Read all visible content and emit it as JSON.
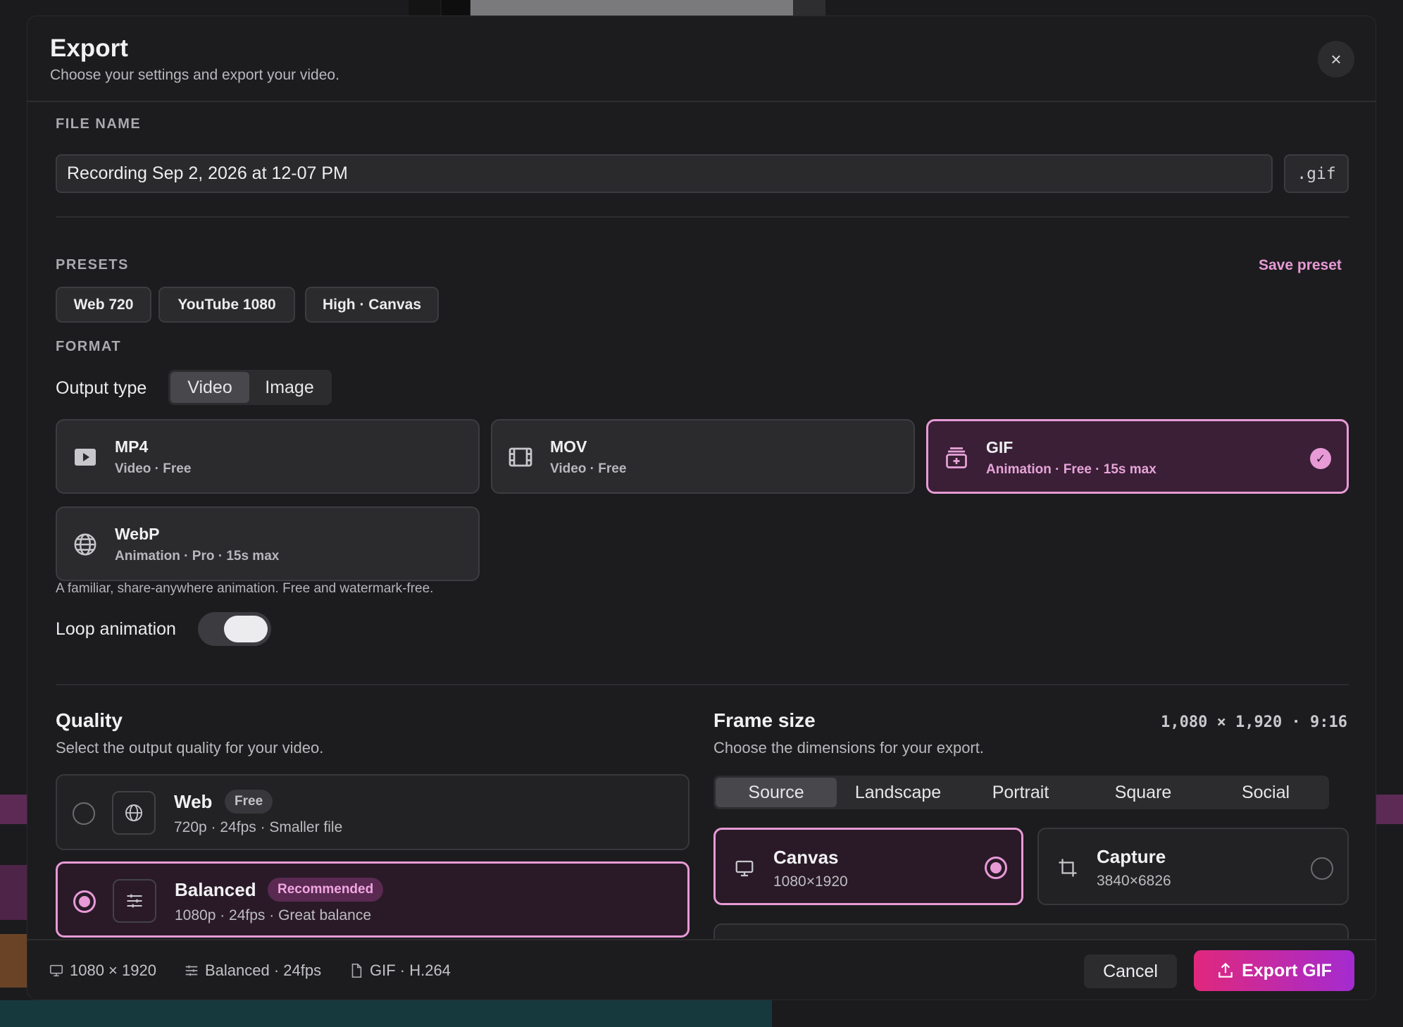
{
  "header": {
    "title": "Export",
    "subtitle": "Choose your settings and export your video.",
    "close_glyph": "×"
  },
  "file_name": {
    "label": "FILE NAME",
    "value": "Recording Sep 2, 2026 at 12-07 PM",
    "extension": ".gif"
  },
  "presets": {
    "label": "PRESETS",
    "save_label": "Save preset",
    "items": [
      "Web 720",
      "YouTube 1080",
      "High · Canvas"
    ]
  },
  "format": {
    "label": "FORMAT",
    "output_type_label": "Output type",
    "output_types": [
      "Video",
      "Image"
    ],
    "selected_output_type": "Video",
    "cards": [
      {
        "name": "MP4",
        "sub": "Video · Free",
        "icon": "play-icon"
      },
      {
        "name": "MOV",
        "sub": "Video · Free",
        "icon": "film-icon"
      },
      {
        "name": "GIF",
        "sub": "Animation · Free · 15s max",
        "icon": "gif-stack-icon",
        "selected": true
      },
      {
        "name": "WebP",
        "sub": "Animation · Pro · 15s max",
        "icon": "globe-icon"
      }
    ],
    "hint": "A familiar, share-anywhere animation. Free and watermark-free.",
    "loop_label": "Loop animation",
    "loop_on": true
  },
  "quality": {
    "title": "Quality",
    "subtitle": "Select the output quality for your video.",
    "options": [
      {
        "name": "Web",
        "badge": "Free",
        "sub": "720p · 24fps · Smaller file",
        "icon": "globe-icon",
        "selected": false
      },
      {
        "name": "Balanced",
        "badge": "Recommended",
        "sub": "1080p · 24fps · Great balance",
        "icon": "sliders-icon",
        "selected": true
      }
    ]
  },
  "frame_size": {
    "title": "Frame size",
    "subtitle": "Choose the dimensions for your export.",
    "dims": "1,080 × 1,920 · 9:16",
    "tabs": [
      "Source",
      "Landscape",
      "Portrait",
      "Square",
      "Social"
    ],
    "selected_tab": "Source",
    "options": [
      {
        "name": "Canvas",
        "sub": "1080×1920",
        "icon": "monitor-icon",
        "selected": true
      },
      {
        "name": "Capture",
        "sub": "3840×6826",
        "icon": "crop-icon",
        "selected": false
      }
    ]
  },
  "footer": {
    "size": "1080 × 1920",
    "quality": "Balanced · 24fps",
    "format": "GIF · H.264",
    "cancel_label": "Cancel",
    "export_label": "Export GIF"
  },
  "colors": {
    "accent": "#e79ad6",
    "export_gradient_start": "#e0287c",
    "export_gradient_end": "#a42bd0"
  }
}
